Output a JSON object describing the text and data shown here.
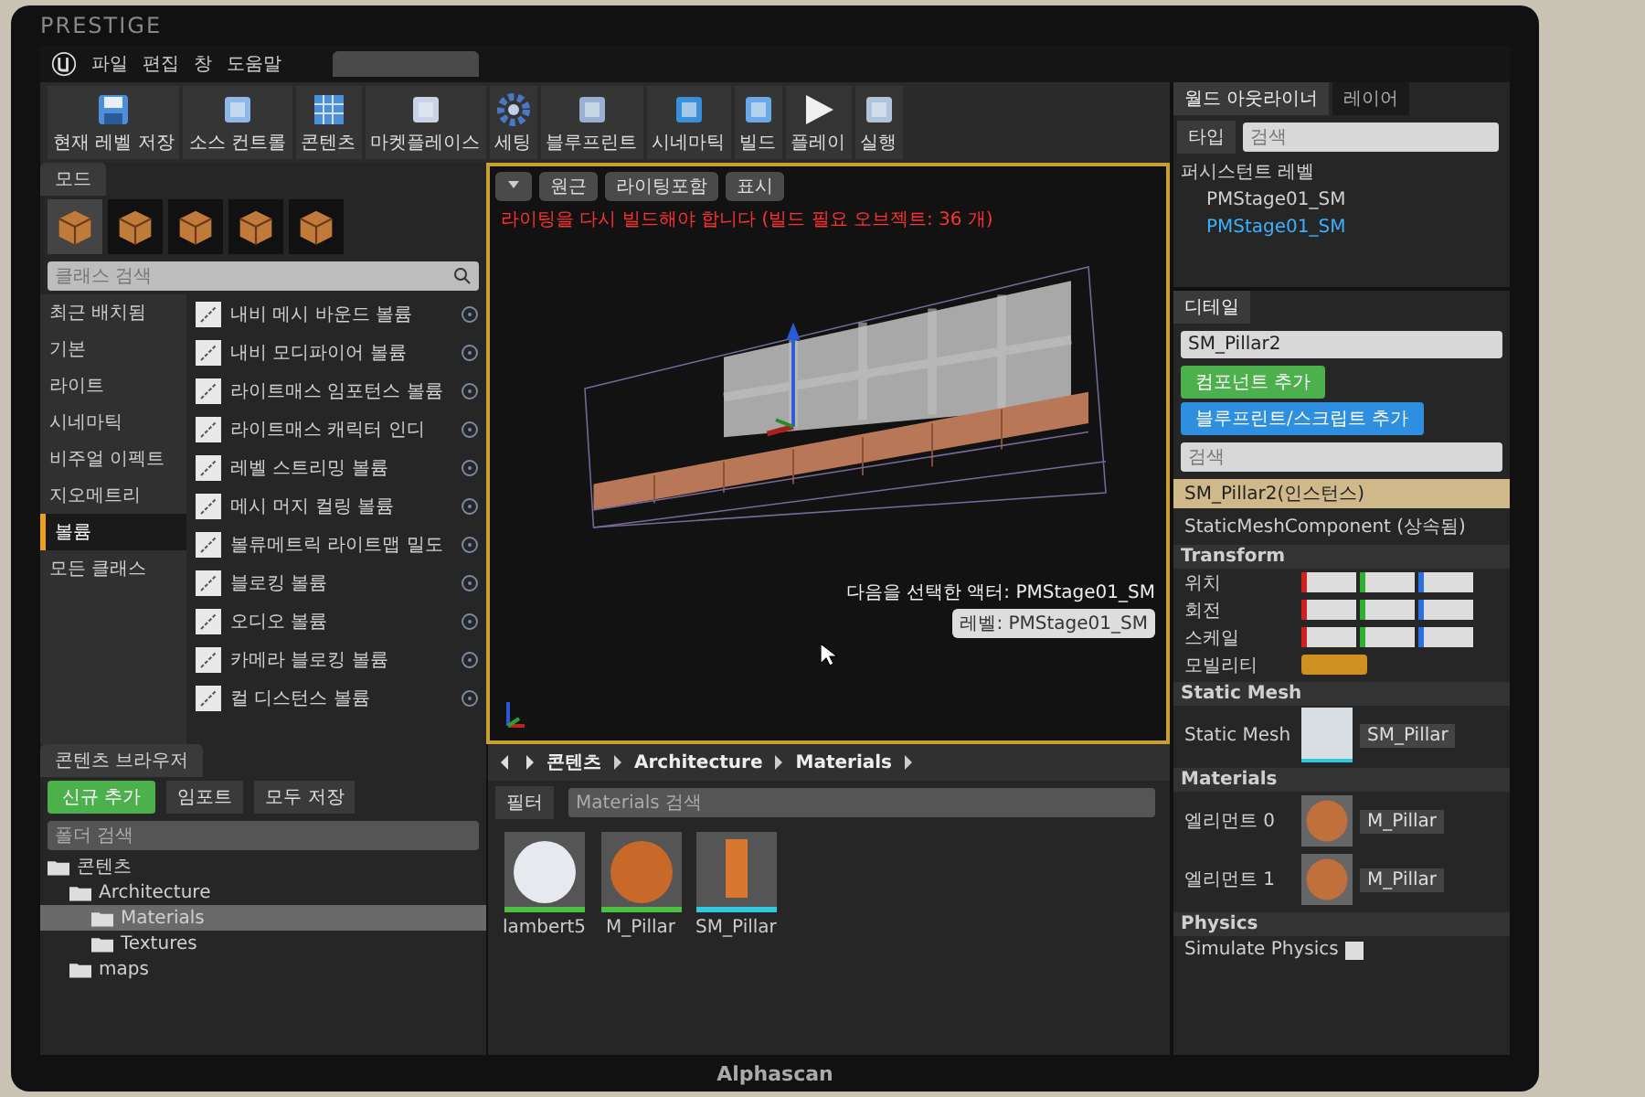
{
  "monitor": {
    "brand": "PRESTIGE",
    "maker": "Alphascan"
  },
  "menu": [
    "파일",
    "편집",
    "창",
    "도움말"
  ],
  "toolbar": [
    {
      "label": "현재 레벨 저장",
      "kind": "save"
    },
    {
      "label": "소스 컨트롤",
      "kind": "source"
    },
    {
      "label": "콘텐츠",
      "kind": "grid"
    },
    {
      "label": "마켓플레이스",
      "kind": "market"
    },
    {
      "label": "세팅",
      "kind": "gear"
    },
    {
      "label": "블루프린트",
      "kind": "blueprint"
    },
    {
      "label": "시네마틱",
      "kind": "clapper"
    },
    {
      "label": "빌드",
      "kind": "build"
    },
    {
      "label": "플레이",
      "kind": "play"
    },
    {
      "label": "실행",
      "kind": "launch"
    }
  ],
  "modes": {
    "title": "모드",
    "search_placeholder": "클래스 검색",
    "categories": [
      {
        "label": "최근 배치됨",
        "selected": false
      },
      {
        "label": "기본",
        "selected": false
      },
      {
        "label": "라이트",
        "selected": false
      },
      {
        "label": "시네마틱",
        "selected": false
      },
      {
        "label": "비주얼 이펙트",
        "selected": false
      },
      {
        "label": "지오메트리",
        "selected": false
      },
      {
        "label": "볼륨",
        "selected": true
      },
      {
        "label": "모든 클래스",
        "selected": false
      }
    ],
    "items": [
      "내비 메시 바운드 볼륨",
      "내비 모디파이어 볼륨",
      "라이트매스 임포턴스 볼륨",
      "라이트매스 캐릭터 인디",
      "레벨 스트리밍 볼륨",
      "메시 머지 컬링 볼륨",
      "볼류메트릭 라이트맵 밀도",
      "블로킹 볼륨",
      "오디오 볼륨",
      "카메라 블로킹 볼륨",
      "컬 디스턴스 볼륨"
    ]
  },
  "viewport": {
    "buttons": [
      "원근",
      "라이팅포함",
      "표시"
    ],
    "warning": "라이팅을 다시 빌드해야 합니다 (빌드 필요 오브젝트: 36 개)",
    "selection_info": [
      "다음을 선택한 액터: PMStage01_SM",
      "레벨: PMStage01_SM"
    ]
  },
  "outliner": {
    "tabs": [
      {
        "label": "월드 아웃라이너",
        "selected": true
      },
      {
        "label": "레이어",
        "selected": false
      }
    ],
    "filter": "타입",
    "search_placeholder": "검색",
    "items": [
      {
        "label": "퍼시스턴트 레벨",
        "selected": false,
        "children": [
          {
            "label": "PMStage01_SM",
            "selected": false
          },
          {
            "label": "PMStage01_SM",
            "selected": true
          }
        ]
      }
    ]
  },
  "details": {
    "tab": "디테일",
    "name": "SM_Pillar2",
    "add_component": "컴포넌트 추가",
    "add_script": "블루프린트/스크립트 추가",
    "search_placeholder": "검색",
    "components": [
      {
        "label": "SM_Pillar2(인스턴스)",
        "selected": true
      },
      {
        "label": "StaticMeshComponent (상속됨)",
        "selected": false
      }
    ],
    "sections": [
      {
        "title": "Transform",
        "kind": "transform",
        "rows": [
          {
            "label": "위치"
          },
          {
            "label": "회전"
          },
          {
            "label": "스케일"
          },
          {
            "label": "모빌리티"
          }
        ]
      },
      {
        "title": "Static Mesh",
        "kind": "mesh",
        "rows": [
          {
            "label": "Static Mesh",
            "value": "SM_Pillar"
          }
        ]
      },
      {
        "title": "Materials",
        "kind": "materials",
        "rows": [
          {
            "label": "엘리먼트 0",
            "value": "M_Pillar"
          },
          {
            "label": "엘리먼트 1",
            "value": "M_Pillar"
          }
        ]
      },
      {
        "title": "Physics",
        "kind": "physics",
        "rows": [
          {
            "label": "Simulate Physics",
            "checked": false
          }
        ]
      }
    ]
  },
  "content_browser": {
    "title": "콘텐츠 브라우저",
    "add_new": "신규 추가",
    "import": "임포트",
    "save_all": "모두 저장",
    "folder_search": "폴더 검색",
    "tree": [
      {
        "label": "콘텐츠",
        "selected": false,
        "children": [
          {
            "label": "Architecture",
            "selected": false,
            "children": [
              {
                "label": "Materials",
                "selected": true
              },
              {
                "label": "Textures",
                "selected": false
              }
            ]
          },
          {
            "label": "maps",
            "selected": false
          }
        ]
      }
    ],
    "path": [
      "콘텐츠",
      "Architecture",
      "Materials"
    ],
    "filter": "필터",
    "search_placeholder": "Materials 검색",
    "assets": [
      {
        "name": "lambert5",
        "kind": "material",
        "color": "#e6eaee"
      },
      {
        "name": "M_Pillar",
        "kind": "material",
        "color": "#c8692a"
      },
      {
        "name": "SM_Pillar",
        "kind": "mesh",
        "color": "#d8782e"
      }
    ]
  }
}
